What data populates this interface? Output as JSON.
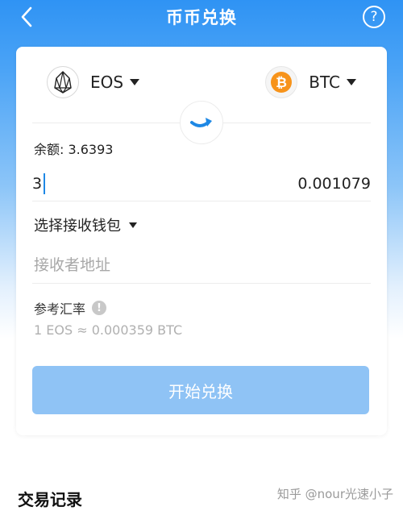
{
  "header": {
    "title": "币币兑换",
    "help_label": "?"
  },
  "exchange": {
    "from_coin": {
      "name": "EOS",
      "icon": "eos-logo-icon"
    },
    "to_coin": {
      "name": "BTC",
      "icon": "bitcoin-logo-icon",
      "color": "#f7931a"
    },
    "balance_text": "余额: 3.6393",
    "amount_input": "3",
    "amount_output": "0.001079",
    "wallet_select_label": "选择接收钱包",
    "address_placeholder": "接收者地址",
    "rate_label": "参考汇率",
    "rate_value": "1 EOS ≈ 0.000359 BTC",
    "start_button": "开始兑换"
  },
  "records": {
    "title": "交易记录"
  },
  "watermark": "知乎 @nour光速小子",
  "colors": {
    "header_blue": "#2f93f4",
    "button_disabled": "#8fc3f5",
    "cursor_blue": "#1e88e5"
  }
}
